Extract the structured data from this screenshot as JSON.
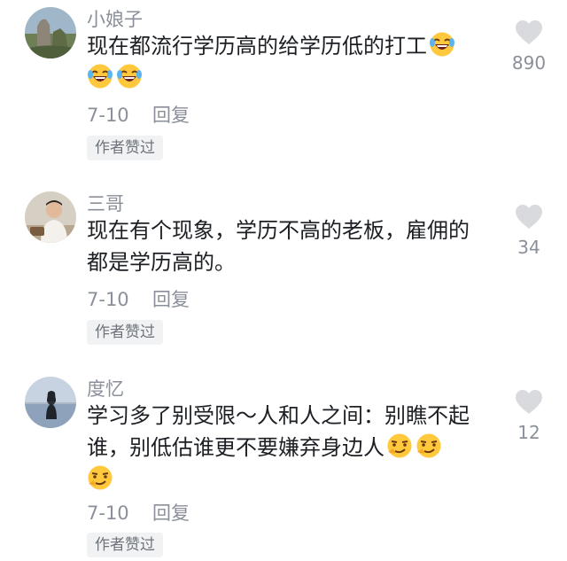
{
  "colors": {
    "text_primary": "#1c1f23",
    "text_secondary": "#8a8f99",
    "badge_bg": "#f1f2f4",
    "heart_gray": "#d8dadd"
  },
  "comments": [
    {
      "username": "小娘子",
      "text": "现在都流行学历高的给学历低的打工",
      "emojis": [
        "laugh-cry-emoji",
        "laugh-cry-emoji",
        "laugh-cry-emoji"
      ],
      "date": "7-10",
      "reply_label": "回复",
      "badge": "作者赞过",
      "like_count": "890",
      "avatar_icon": "avatar-landscape"
    },
    {
      "username": "三哥",
      "text": "现在有个现象，学历不高的老板，雇佣的都是学历高的。",
      "emojis": [],
      "date": "7-10",
      "reply_label": "回复",
      "badge": "作者赞过",
      "like_count": "34",
      "avatar_icon": "avatar-person"
    },
    {
      "username": "度忆",
      "text": "学习多了别受限～人和人之间：别瞧不起谁，别低估谁更不要嫌弃身边人",
      "emojis": [
        "smirk-emoji",
        "smirk-emoji",
        "smirk-emoji"
      ],
      "date": "7-10",
      "reply_label": "回复",
      "badge": "作者赞过",
      "like_count": "12",
      "avatar_icon": "avatar-lake"
    }
  ]
}
